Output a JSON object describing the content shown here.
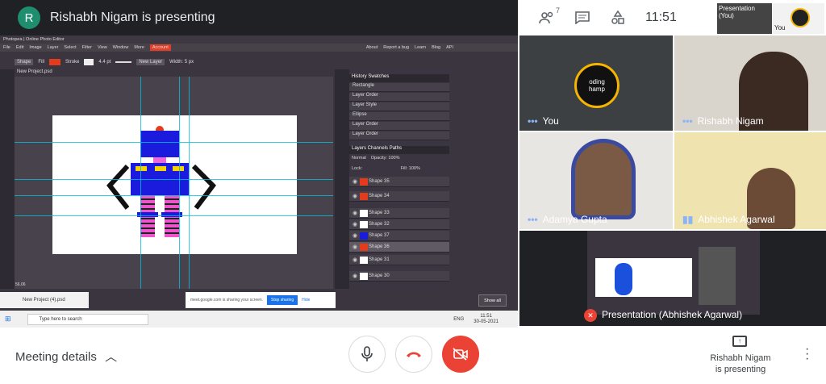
{
  "meeting": {
    "avatar_letter": "R",
    "presenting_title": "Rishabh Nigam is presenting",
    "people_count": "7",
    "time": "11:51",
    "thumb_presentation": "Presentation",
    "thumb_you_label": "(You)",
    "thumb_you": "You",
    "meeting_details": "Meeting details",
    "presenting_who": "Rishabh Nigam",
    "presenting_is": "is presenting"
  },
  "participants": [
    {
      "name": "You",
      "logo_line1": "oding",
      "logo_line2": "hamp"
    },
    {
      "name": "Rishabh Nigam"
    },
    {
      "name": "Adamya Gupta"
    },
    {
      "name": "Abhishek Agarwal"
    },
    {
      "name": "Presentation (Abhishek Agarwal)"
    }
  ],
  "photopea": {
    "window_title": "Photopea | Online Photo Editor",
    "menu": [
      "File",
      "Edit",
      "Image",
      "Layer",
      "Select",
      "Filter",
      "View",
      "Window",
      "More",
      "Account"
    ],
    "top_right_links": [
      "About",
      "Report a bug",
      "Learn",
      "Blog",
      "API"
    ],
    "opt_shape": "Shape",
    "opt_fill": "Fill",
    "opt_stroke": "Stroke",
    "opt_stroke_size": "4.4 pt",
    "opt_new_layer": "New Layer",
    "opt_width": "Width: 5 px",
    "doc_tab": "New Project.psd",
    "history_tabs": "History  Swatches",
    "history": [
      "Rectangle",
      "Layer Order",
      "Layer Style",
      "Ellipse",
      "Layer Order",
      "Layer Order"
    ],
    "layers_tabs": "Layers  Channels  Paths",
    "blend": "Normal",
    "opacity": "Opacity: 100%",
    "lock": "Lock:",
    "fill": "Fill: 100%",
    "layers": [
      "Shape 35",
      "Shape 34",
      "Shape 33",
      "Shape 32",
      "Shape 37",
      "Shape 36",
      "Shape 31",
      "Shape 30"
    ],
    "zoom": "56.06"
  },
  "windows": {
    "file_tab": "New Project (4).psd",
    "share_text": "meet.google.com is sharing your screen.",
    "stop_sharing": "Stop sharing",
    "hide": "Hide",
    "show_all": "Show all",
    "search_placeholder": "Type here to search",
    "lang": "ENG",
    "clock_time": "11:51",
    "clock_date": "30-05-2021"
  },
  "colors": {
    "end_call": "#ea4335",
    "accent": "#1a73e8"
  }
}
